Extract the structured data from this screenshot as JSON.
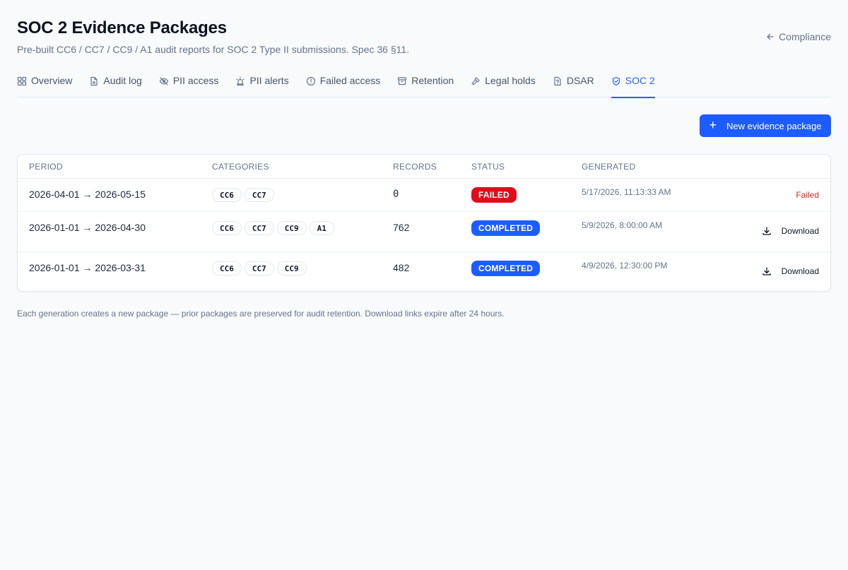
{
  "header": {
    "title": "SOC 2 Evidence Packages",
    "subtitle": "Pre-built CC6 / CC7 / CC9 / A1 audit reports for SOC 2 Type II submissions. Spec 36 §11.",
    "back_label": "Compliance"
  },
  "tabs": [
    {
      "label": "Overview",
      "icon": "grid-icon"
    },
    {
      "label": "Audit log",
      "icon": "document-icon"
    },
    {
      "label": "PII access",
      "icon": "eye-off-icon"
    },
    {
      "label": "PII alerts",
      "icon": "siren-icon"
    },
    {
      "label": "Failed access",
      "icon": "alert-circle-icon"
    },
    {
      "label": "Retention",
      "icon": "archive-icon"
    },
    {
      "label": "Legal holds",
      "icon": "gavel-icon"
    },
    {
      "label": "DSAR",
      "icon": "file-question-icon"
    },
    {
      "label": "SOC 2",
      "icon": "shield-check-icon",
      "active": true
    }
  ],
  "actions": {
    "new_package_label": "New evidence package"
  },
  "table": {
    "columns": [
      "PERIOD",
      "CATEGORIES",
      "RECORDS",
      "STATUS",
      "GENERATED"
    ],
    "rows": [
      {
        "period": "2026-04-01 → 2026-05-15",
        "categories": [
          "CC6",
          "CC7"
        ],
        "records": "0",
        "status": "FAILED",
        "generated": "5/17/2026, 11:13:33 AM",
        "action": "Failed"
      },
      {
        "period": "2026-01-01 → 2026-04-30",
        "categories": [
          "CC6",
          "CC7",
          "CC9",
          "A1"
        ],
        "records": "762",
        "status": "COMPLETED",
        "generated": "5/9/2026, 8:00:00 AM",
        "action": "Download"
      },
      {
        "period": "2026-01-01 → 2026-03-31",
        "categories": [
          "CC6",
          "CC7",
          "CC9"
        ],
        "records": "482",
        "status": "COMPLETED",
        "generated": "4/9/2026, 12:30:00 PM",
        "action": "Download"
      }
    ]
  },
  "footnote": "Each generation creates a new package — prior packages are preserved for audit retention. Download links expire after 24 hours.",
  "colors": {
    "accent": "#1d5cff",
    "failed": "#e00d1b",
    "failed_text": "#dc2626"
  }
}
